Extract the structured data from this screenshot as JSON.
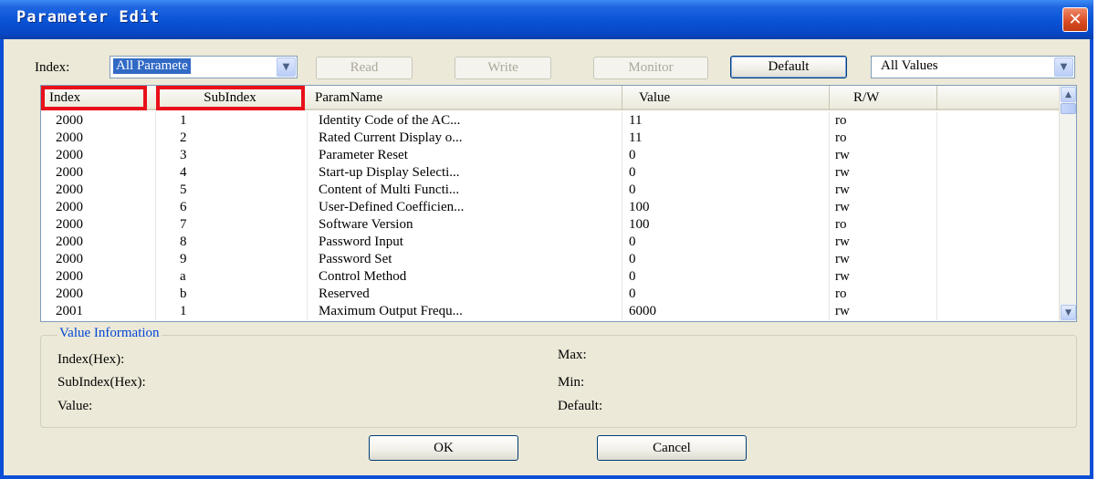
{
  "window": {
    "title": "Parameter Edit",
    "close_glyph": "✕"
  },
  "toolbar": {
    "index_label": "Index:",
    "index_select_value": "All Paramete",
    "read_label": "Read",
    "write_label": "Write",
    "monitor_label": "Monitor",
    "default_label": "Default",
    "values_select_value": "All Values"
  },
  "grid": {
    "columns": [
      "Index",
      "SubIndex",
      "ParamName",
      "Value",
      "R/W"
    ],
    "rows": [
      {
        "index": "2000",
        "subindex": "1",
        "name": "Identity Code of the AC...",
        "value": "11",
        "rw": "ro"
      },
      {
        "index": "2000",
        "subindex": "2",
        "name": "Rated Current Display o...",
        "value": "11",
        "rw": "ro"
      },
      {
        "index": "2000",
        "subindex": "3",
        "name": "Parameter Reset",
        "value": "0",
        "rw": "rw"
      },
      {
        "index": "2000",
        "subindex": "4",
        "name": "Start-up Display Selecti...",
        "value": "0",
        "rw": "rw"
      },
      {
        "index": "2000",
        "subindex": "5",
        "name": "Content of Multi Functi...",
        "value": "0",
        "rw": "rw"
      },
      {
        "index": "2000",
        "subindex": "6",
        "name": "User-Defined Coefficien...",
        "value": "100",
        "rw": "rw"
      },
      {
        "index": "2000",
        "subindex": "7",
        "name": "Software Version",
        "value": "100",
        "rw": "ro"
      },
      {
        "index": "2000",
        "subindex": "8",
        "name": "Password Input",
        "value": "0",
        "rw": "rw"
      },
      {
        "index": "2000",
        "subindex": "9",
        "name": "Password Set",
        "value": "0",
        "rw": "rw"
      },
      {
        "index": "2000",
        "subindex": "a",
        "name": "Control Method",
        "value": "0",
        "rw": "rw"
      },
      {
        "index": "2000",
        "subindex": "b",
        "name": "Reserved",
        "value": "0",
        "rw": "ro"
      },
      {
        "index": "2001",
        "subindex": "1",
        "name": "Maximum Output Frequ...",
        "value": "6000",
        "rw": "rw"
      }
    ]
  },
  "value_info": {
    "title": "Value Information",
    "index_hex_label": "Index(Hex):",
    "subindex_hex_label": "SubIndex(Hex):",
    "value_label": "Value:",
    "max_label": "Max:",
    "min_label": "Min:",
    "default_label": "Default:"
  },
  "footer": {
    "ok_label": "OK",
    "cancel_label": "Cancel"
  },
  "colors": {
    "title_bar": "#0a55d7",
    "highlight_border": "#e8101a",
    "group_title": "#0046d5",
    "dialog_bg": "#ece9d8"
  },
  "icons": {
    "dropdown": "chevron-down-icon",
    "scroll_up": "chevron-up-icon",
    "scroll_down": "chevron-down-icon",
    "close": "close-icon"
  }
}
